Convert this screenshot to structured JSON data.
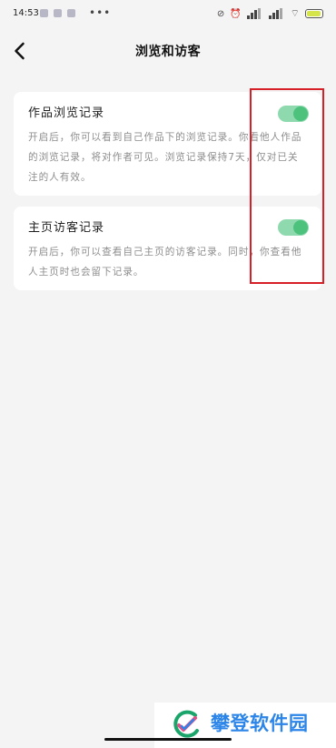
{
  "status_bar": {
    "time": "14:53"
  },
  "header": {
    "title": "浏览和访客"
  },
  "settings": [
    {
      "title": "作品浏览记录",
      "description": "开启后，你可以看到自己作品下的浏览记录。你看他人作品的浏览记录，将对作者可见。浏览记录保持7天，仅对已关注的人有效。",
      "enabled": true
    },
    {
      "title": "主页访客记录",
      "description": "开启后，你可以查看自己主页的访客记录。同时，你查看他人主页时也会留下记录。",
      "enabled": true
    }
  ],
  "watermark": {
    "text": "攀登软件园"
  },
  "colors": {
    "background": "#f4f4f4",
    "card": "#ffffff",
    "toggle_on": "#4cc27d",
    "highlight": "#d61f26",
    "watermark_blue": "#2c85e8"
  }
}
